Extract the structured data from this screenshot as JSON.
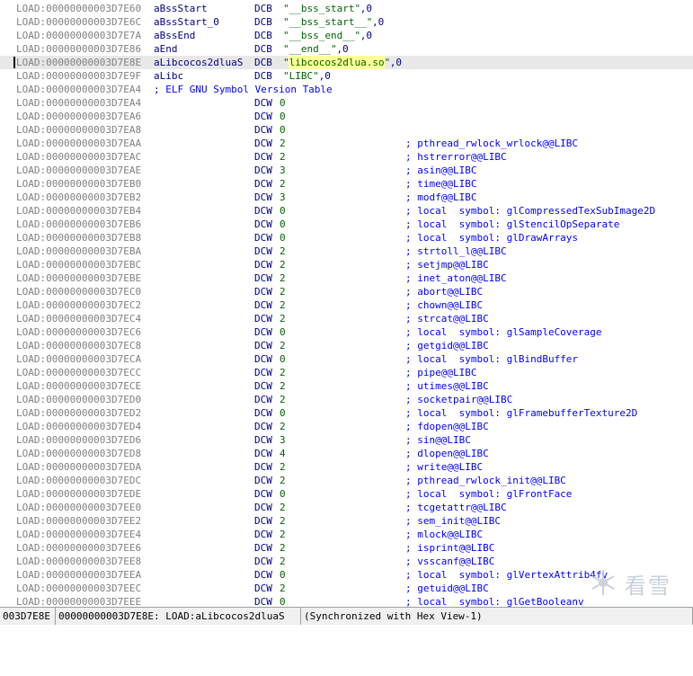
{
  "listing": [
    {
      "addr": "LOAD:00000000003D7E60",
      "name": "aBssStart",
      "op": "DCB",
      "str": "\"__bss_start\"",
      "tail": ",0",
      "comment": ""
    },
    {
      "addr": "LOAD:00000000003D7E6C",
      "name": "aBssStart_0",
      "op": "DCB",
      "str": "\"__bss_start__\"",
      "tail": ",0",
      "comment": ""
    },
    {
      "addr": "LOAD:00000000003D7E7A",
      "name": "aBssEnd",
      "op": "DCB",
      "str": "\"__bss_end__\"",
      "tail": ",0",
      "comment": ""
    },
    {
      "addr": "LOAD:00000000003D7E86",
      "name": "aEnd",
      "op": "DCB",
      "str": "\"__end__\"",
      "tail": ",0",
      "comment": ""
    },
    {
      "addr": "LOAD:00000000003D7E8E",
      "name": "aLibcocos2dluaS",
      "op": "DCB",
      "str": "\"libcocos2dlua.so\"",
      "tail": ",0",
      "comment": "",
      "selected": true
    },
    {
      "addr": "LOAD:00000000003D7E9F",
      "name": "aLibc",
      "op": "DCB",
      "str": "\"LIBC\"",
      "tail": ",0",
      "comment": ""
    },
    {
      "addr": "LOAD:00000000003D7EA4",
      "section_comment": "; ELF GNU Symbol Version Table"
    },
    {
      "addr": "LOAD:00000000003D7EA4",
      "name": "",
      "op": "DCW",
      "val": "0",
      "comment": ""
    },
    {
      "addr": "LOAD:00000000003D7EA6",
      "name": "",
      "op": "DCW",
      "val": "0",
      "comment": ""
    },
    {
      "addr": "LOAD:00000000003D7EA8",
      "name": "",
      "op": "DCW",
      "val": "0",
      "comment": ""
    },
    {
      "addr": "LOAD:00000000003D7EAA",
      "name": "",
      "op": "DCW",
      "val": "2",
      "comment": "; pthread_rwlock_wrlock@@LIBC"
    },
    {
      "addr": "LOAD:00000000003D7EAC",
      "name": "",
      "op": "DCW",
      "val": "2",
      "comment": "; hstrerror@@LIBC"
    },
    {
      "addr": "LOAD:00000000003D7EAE",
      "name": "",
      "op": "DCW",
      "val": "3",
      "comment": "; asin@@LIBC"
    },
    {
      "addr": "LOAD:00000000003D7EB0",
      "name": "",
      "op": "DCW",
      "val": "2",
      "comment": "; time@@LIBC"
    },
    {
      "addr": "LOAD:00000000003D7EB2",
      "name": "",
      "op": "DCW",
      "val": "3",
      "comment": "; modf@@LIBC"
    },
    {
      "addr": "LOAD:00000000003D7EB4",
      "name": "",
      "op": "DCW",
      "val": "0",
      "comment": "; local  symbol: glCompressedTexSubImage2D"
    },
    {
      "addr": "LOAD:00000000003D7EB6",
      "name": "",
      "op": "DCW",
      "val": "0",
      "comment": "; local  symbol: glStencilOpSeparate"
    },
    {
      "addr": "LOAD:00000000003D7EB8",
      "name": "",
      "op": "DCW",
      "val": "0",
      "comment": "; local  symbol: glDrawArrays"
    },
    {
      "addr": "LOAD:00000000003D7EBA",
      "name": "",
      "op": "DCW",
      "val": "2",
      "comment": "; strtoll_l@@LIBC"
    },
    {
      "addr": "LOAD:00000000003D7EBC",
      "name": "",
      "op": "DCW",
      "val": "2",
      "comment": "; setjmp@@LIBC"
    },
    {
      "addr": "LOAD:00000000003D7EBE",
      "name": "",
      "op": "DCW",
      "val": "2",
      "comment": "; inet_aton@@LIBC"
    },
    {
      "addr": "LOAD:00000000003D7EC0",
      "name": "",
      "op": "DCW",
      "val": "2",
      "comment": "; abort@@LIBC"
    },
    {
      "addr": "LOAD:00000000003D7EC2",
      "name": "",
      "op": "DCW",
      "val": "2",
      "comment": "; chown@@LIBC"
    },
    {
      "addr": "LOAD:00000000003D7EC4",
      "name": "",
      "op": "DCW",
      "val": "2",
      "comment": "; strcat@@LIBC"
    },
    {
      "addr": "LOAD:00000000003D7EC6",
      "name": "",
      "op": "DCW",
      "val": "0",
      "comment": "; local  symbol: glSampleCoverage"
    },
    {
      "addr": "LOAD:00000000003D7EC8",
      "name": "",
      "op": "DCW",
      "val": "2",
      "comment": "; getgid@@LIBC"
    },
    {
      "addr": "LOAD:00000000003D7ECA",
      "name": "",
      "op": "DCW",
      "val": "0",
      "comment": "; local  symbol: glBindBuffer"
    },
    {
      "addr": "LOAD:00000000003D7ECC",
      "name": "",
      "op": "DCW",
      "val": "2",
      "comment": "; pipe@@LIBC"
    },
    {
      "addr": "LOAD:00000000003D7ECE",
      "name": "",
      "op": "DCW",
      "val": "2",
      "comment": "; utimes@@LIBC"
    },
    {
      "addr": "LOAD:00000000003D7ED0",
      "name": "",
      "op": "DCW",
      "val": "2",
      "comment": "; socketpair@@LIBC"
    },
    {
      "addr": "LOAD:00000000003D7ED2",
      "name": "",
      "op": "DCW",
      "val": "0",
      "comment": "; local  symbol: glFramebufferTexture2D"
    },
    {
      "addr": "LOAD:00000000003D7ED4",
      "name": "",
      "op": "DCW",
      "val": "2",
      "comment": "; fdopen@@LIBC"
    },
    {
      "addr": "LOAD:00000000003D7ED6",
      "name": "",
      "op": "DCW",
      "val": "3",
      "comment": "; sin@@LIBC"
    },
    {
      "addr": "LOAD:00000000003D7ED8",
      "name": "",
      "op": "DCW",
      "val": "4",
      "comment": "; dlopen@@LIBC"
    },
    {
      "addr": "LOAD:00000000003D7EDA",
      "name": "",
      "op": "DCW",
      "val": "2",
      "comment": "; write@@LIBC"
    },
    {
      "addr": "LOAD:00000000003D7EDC",
      "name": "",
      "op": "DCW",
      "val": "2",
      "comment": "; pthread_rwlock_init@@LIBC"
    },
    {
      "addr": "LOAD:00000000003D7EDE",
      "name": "",
      "op": "DCW",
      "val": "0",
      "comment": "; local  symbol: glFrontFace"
    },
    {
      "addr": "LOAD:00000000003D7EE0",
      "name": "",
      "op": "DCW",
      "val": "2",
      "comment": "; tcgetattr@@LIBC"
    },
    {
      "addr": "LOAD:00000000003D7EE2",
      "name": "",
      "op": "DCW",
      "val": "2",
      "comment": "; sem_init@@LIBC"
    },
    {
      "addr": "LOAD:00000000003D7EE4",
      "name": "",
      "op": "DCW",
      "val": "2",
      "comment": "; mlock@@LIBC"
    },
    {
      "addr": "LOAD:00000000003D7EE6",
      "name": "",
      "op": "DCW",
      "val": "2",
      "comment": "; isprint@@LIBC"
    },
    {
      "addr": "LOAD:00000000003D7EE8",
      "name": "",
      "op": "DCW",
      "val": "2",
      "comment": "; vsscanf@@LIBC"
    },
    {
      "addr": "LOAD:00000000003D7EEA",
      "name": "",
      "op": "DCW",
      "val": "0",
      "comment": "; local  symbol: glVertexAttrib4fv"
    },
    {
      "addr": "LOAD:00000000003D7EEC",
      "name": "",
      "op": "DCW",
      "val": "2",
      "comment": "; getuid@@LIBC"
    },
    {
      "addr": "LOAD:00000000003D7EEE",
      "name": "",
      "op": "DCW",
      "val": "0",
      "comment": "; local  symbol: glGetBooleanv"
    }
  ],
  "statusbar": {
    "address": "003D7E8E",
    "location": "00000000003D7E8E: LOAD:aLibcocos2dluaS",
    "sync": "(Synchronized with Hex View-1)"
  },
  "watermark": {
    "text": "看雪",
    "icon": "snowflake-icon"
  }
}
